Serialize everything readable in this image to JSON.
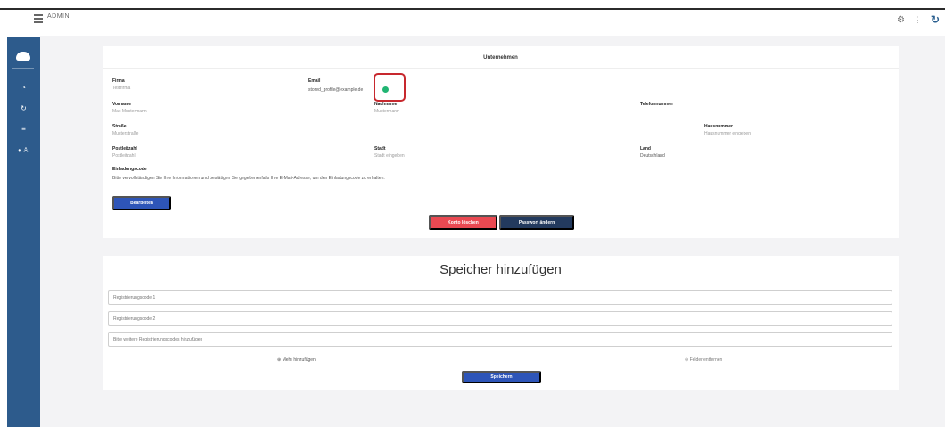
{
  "topbar": {
    "brand": "ADMIN",
    "icons": [
      "menu-icon",
      "gear-icon",
      "more-icon",
      "refresh-icon"
    ]
  },
  "sidebar": {
    "icons": [
      "logo-icon",
      "dashboard-icon",
      "sync-icon",
      "list-icon",
      "user-icon"
    ]
  },
  "profile": {
    "title": "Unternehmen",
    "fields": {
      "firma_label": "Firma",
      "firma_value": "Testfirma",
      "email_label": "Email",
      "email_value": "stored_profile@example.de",
      "vorname_label": "Vorname",
      "vorname_value": "Max Mustermann",
      "nachname_label": "Nachname",
      "nachname_value": "Mustermann",
      "telefon_label": "Telefonnummer",
      "strasse_label": "Straße",
      "strasse_value": "Musterstraße",
      "hausnummer_label": "Hausnummer",
      "hausnummer_value": "Hausnummer eingeben",
      "plz_label": "Postleitzahl",
      "plz_value": "Postleitzahl",
      "stadt_label": "Stadt",
      "stadt_value": "Stadt eingeben",
      "land_label": "Land",
      "land_value": "Deutschland",
      "code_label": "Einladungscode"
    },
    "note": "Bitte vervollständigen Sie Ihre Informationen und bestätigen Sie gegebenenfalls Ihre E-Mail-Adresse, um den Einladungscode zu erhalten.",
    "buttons": {
      "edit": "Bearbeiten",
      "delete": "Konto löschen",
      "password": "Passwort ändern"
    },
    "colors": {
      "verified": "#21b573",
      "highlight": "#c7282e",
      "primary": "#2e55b8",
      "danger": "#e94952",
      "dark": "#233a5e"
    }
  },
  "storage": {
    "title": "Speicher hinzufügen",
    "inputs": [
      {
        "placeholder": "Registrierungscode 1"
      },
      {
        "placeholder": "Registrierungscode 2"
      },
      {
        "placeholder": "Bitte weitere Registrierungscodes hinzufügen"
      }
    ],
    "add_more": "Mehr hinzufügen",
    "reset": "Felder entfernen",
    "save": "Speichern"
  }
}
